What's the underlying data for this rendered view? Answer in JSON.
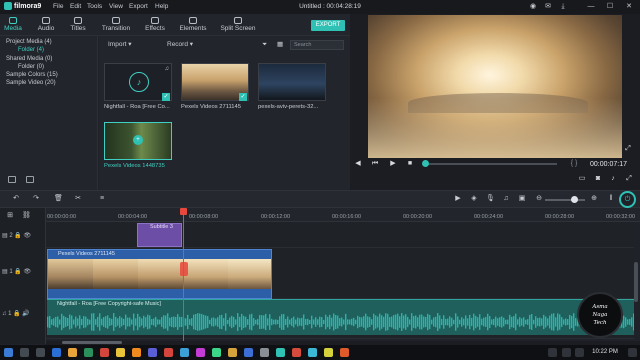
{
  "app": {
    "name": "filmora9",
    "doc_title": "Untitled : 00:04:28:19"
  },
  "menu": [
    "File",
    "Edit",
    "Tools",
    "View",
    "Export",
    "Help"
  ],
  "window_controls": {
    "minimize": "—",
    "maximize": "☐",
    "close": "✕"
  },
  "tabs": [
    {
      "label": "Media",
      "active": true
    },
    {
      "label": "Audio"
    },
    {
      "label": "Titles"
    },
    {
      "label": "Transition"
    },
    {
      "label": "Effects"
    },
    {
      "label": "Elements"
    },
    {
      "label": "Split Screen"
    }
  ],
  "export_label": "EXPORT",
  "tree": [
    {
      "label": "Project Media (4)"
    },
    {
      "label": "Folder (4)",
      "selected": true
    },
    {
      "label": "Shared Media (0)"
    },
    {
      "label": "Folder (0)"
    },
    {
      "label": "Sample Colors (15)"
    },
    {
      "label": "Sample Video (20)"
    }
  ],
  "media_toolbar": {
    "import": "Import",
    "record": "Record",
    "search_placeholder": "Search"
  },
  "media_items": [
    {
      "label": "Nightfall - Roa [Free Co...",
      "kind": "audio",
      "checked": true
    },
    {
      "label": "Pexels Videos 2711145",
      "kind": "video",
      "checked": true
    },
    {
      "label": "pexels-aviv-perets-32...",
      "kind": "video",
      "checked": false
    },
    {
      "label": "Pexels Videos 1448735",
      "kind": "video",
      "selected": true
    }
  ],
  "player": {
    "timecode": "00:00:07:17",
    "progress": 0.02,
    "brackets": "{ }"
  },
  "ruler": [
    "00:00:00:00",
    "00:00:04:00",
    "00:00:08:00",
    "00:00:12:00",
    "00:00:16:00",
    "00:00:20:00",
    "00:00:24:00",
    "00:00:28:00",
    "00:00:32:00"
  ],
  "tracks": {
    "title_track": {
      "num": "2",
      "clip": "Subtitle 3"
    },
    "video_track": {
      "num": "1",
      "clip": "Pexels Videos 2711145"
    },
    "audio_track": {
      "num": "1",
      "clip": "Nightfall - Roa [Free Copyright-safe Music]"
    }
  },
  "watermark": {
    "line1": "Asma",
    "line2": "Naga",
    "line3": "Tech"
  },
  "clock": "10:22 PM",
  "colors": {
    "accent": "#2fc1b4",
    "title_clip": "#6d4ea7",
    "video_clip": "#2d5fa8",
    "audio_clip": "#1f5f5c",
    "playhead": "#e8473b"
  }
}
